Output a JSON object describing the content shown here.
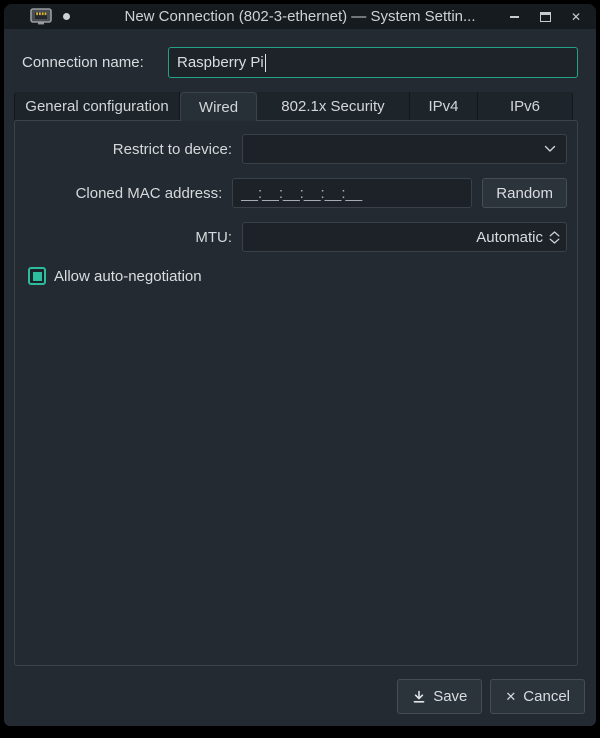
{
  "window": {
    "title": "New Connection (802-3-ethernet) — System Settin...",
    "titlebar_icons": {
      "app_icon": "ethernet-connector",
      "pin_dot": "dot-indicator",
      "minimize": "minimize",
      "maximize": "maximize",
      "close_glyph": "✕"
    }
  },
  "name_row": {
    "label": "Connection name:",
    "value": "Raspberry Pi"
  },
  "tabs": [
    {
      "label": "General configuration",
      "active": false
    },
    {
      "label": "Wired",
      "active": true
    },
    {
      "label": "802.1x Security",
      "active": false
    },
    {
      "label": "IPv4",
      "active": false
    },
    {
      "label": "IPv6",
      "active": false
    }
  ],
  "wired_tab": {
    "restrict_label": "Restrict to device:",
    "restrict_value": "",
    "mac_label": "Cloned MAC address:",
    "mac_value": "__:__:__:__:__:__",
    "random_button": "Random",
    "mtu_label": "MTU:",
    "mtu_value": "Automatic",
    "autoneg_label": "Allow auto-negotiation",
    "autoneg_checked": true
  },
  "footer": {
    "save_label": "Save",
    "cancel_label": "Cancel",
    "cancel_glyph": "✕"
  },
  "colors": {
    "accent": "#2cbc9e",
    "focus_border": "#22a287",
    "window_bg": "#232a31",
    "titlebar_bg": "#161b20",
    "input_bg": "#1c2228",
    "text": "#dadde0"
  }
}
